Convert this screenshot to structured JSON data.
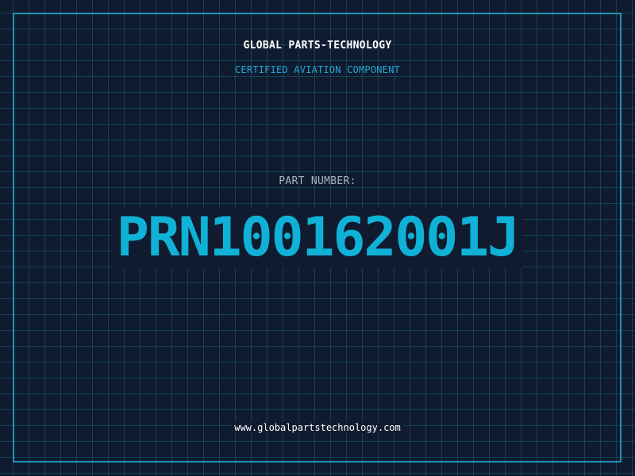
{
  "header": {
    "company": "GLOBAL PARTS-TECHNOLOGY",
    "subtitle": "CERTIFIED AVIATION COMPONENT"
  },
  "part": {
    "label": "PART NUMBER:",
    "number": "PRN100162001J"
  },
  "footer": {
    "url": "www.globalpartstechnology.com"
  },
  "colors": {
    "background": "#111b2f",
    "grid": "#14607c",
    "border": "#1f93b8",
    "accent": "#0fb2d6",
    "subtitle": "#1ea9d4",
    "label": "#a9b3c1",
    "text": "#ffffff"
  }
}
